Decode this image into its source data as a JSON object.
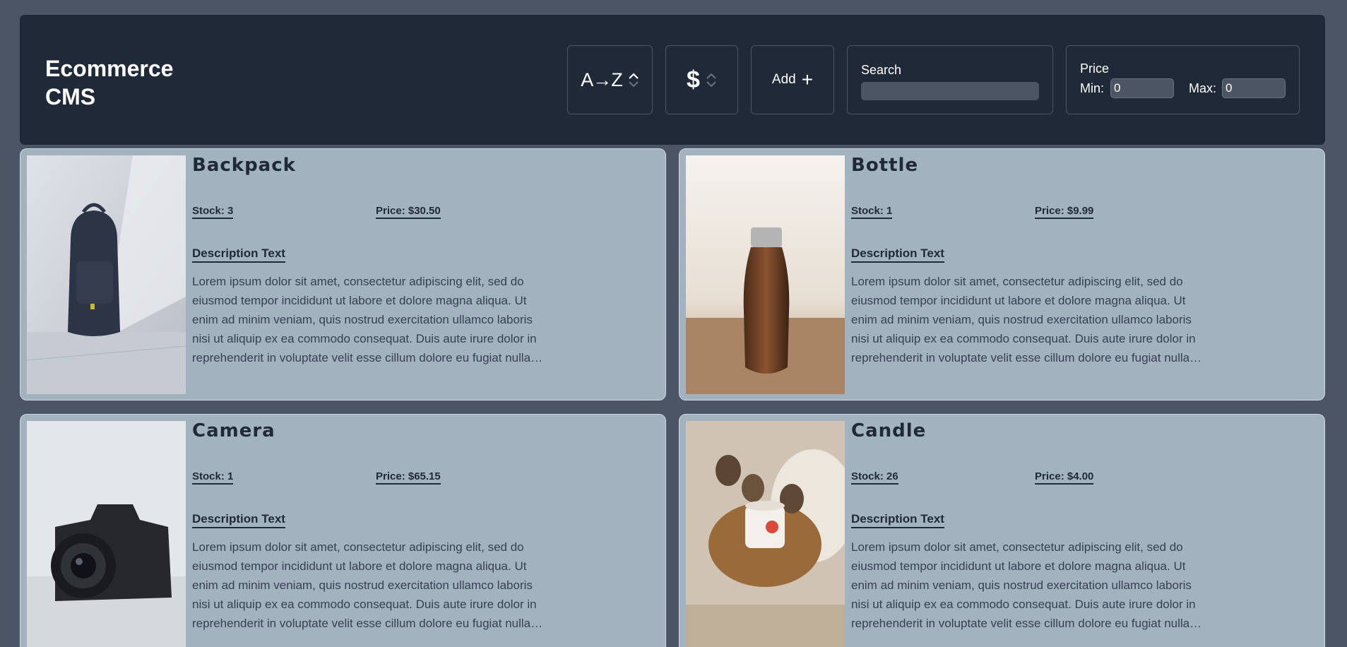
{
  "header": {
    "brand_line1": "Ecommerce",
    "brand_line2": "CMS",
    "sort_name_label": "A→Z",
    "sort_price_label": "$",
    "add_label": "Add",
    "add_icon": "+",
    "search_label": "Search",
    "search_value": "",
    "price_label": "Price",
    "min_label": "Min:",
    "min_value": "0",
    "max_label": "Max:",
    "max_value": "0"
  },
  "products": [
    {
      "name": "Backpack",
      "stock": "Stock: 3",
      "price": "Price: $30.50",
      "desc_title": "Description Text",
      "desc": "Lorem ipsum dolor sit amet, consectetur adipiscing elit, sed do eiusmod tempor incididunt ut labore et dolore magna aliqua. Ut enim ad minim veniam, quis nostrud exercitation ullamco laboris nisi ut aliquip ex ea commodo consequat. Duis aute irure dolor in reprehenderit in voluptate velit esse cillum dolore eu fugiat nulla pariatur."
    },
    {
      "name": "Bottle",
      "stock": "Stock: 1",
      "price": "Price: $9.99",
      "desc_title": "Description Text",
      "desc": "Lorem ipsum dolor sit amet, consectetur adipiscing elit, sed do eiusmod tempor incididunt ut labore et dolore magna aliqua. Ut enim ad minim veniam, quis nostrud exercitation ullamco laboris nisi ut aliquip ex ea commodo consequat. Duis aute irure dolor in reprehenderit in voluptate velit esse cillum dolore eu fugiat nulla pariatur."
    },
    {
      "name": "Camera",
      "stock": "Stock: 1",
      "price": "Price: $65.15",
      "desc_title": "Description Text",
      "desc": "Lorem ipsum dolor sit amet, consectetur adipiscing elit, sed do eiusmod tempor incididunt ut labore et dolore magna aliqua. Ut enim ad minim veniam, quis nostrud exercitation ullamco laboris nisi ut aliquip ex ea commodo consequat. Duis aute irure dolor in reprehenderit in voluptate velit esse cillum dolore eu fugiat nulla pariatur."
    },
    {
      "name": "Candle",
      "stock": "Stock: 26",
      "price": "Price: $4.00",
      "desc_title": "Description Text",
      "desc": "Lorem ipsum dolor sit amet, consectetur adipiscing elit, sed do eiusmod tempor incididunt ut labore et dolore magna aliqua. Ut enim ad minim veniam, quis nostrud exercitation ullamco laboris nisi ut aliquip ex ea commodo consequat. Duis aute irure dolor in reprehenderit in voluptate velit esse cillum dolore eu fugiat nulla pariatur."
    }
  ],
  "icons": {
    "sort_name": "chevron-up-down-icon",
    "sort_price": "chevron-up-down-icon",
    "add": "plus-icon"
  },
  "colors": {
    "page_bg": "#4b5565",
    "header_bg": "#1f2937",
    "card_bg": "#a2b2bf",
    "text_dark": "#1f2937"
  }
}
